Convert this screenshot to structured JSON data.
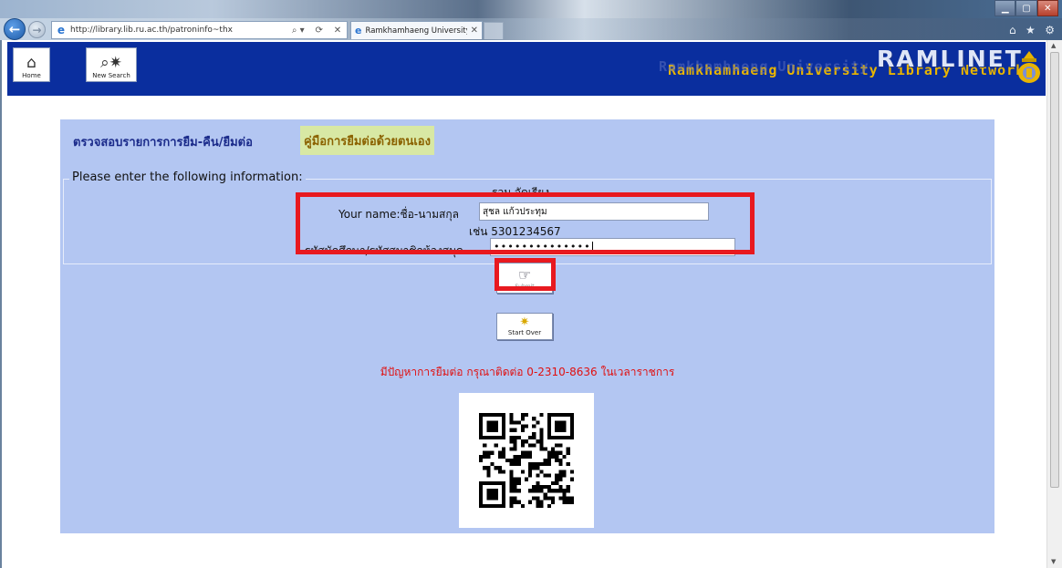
{
  "browser": {
    "url": "http://library.lib.ru.ac.th/patroninfo~thx",
    "tab_title": "Ramkhamhaeng University ...",
    "url_tools": [
      "⌕ ▾",
      "⟳",
      "✕"
    ]
  },
  "header": {
    "home_label": "Home",
    "new_search_label": "New Search",
    "logo_main": "RAMLINET",
    "logo_sub": "Ramkhamhaeng University Library Network",
    "logo_ghost": "Ramkhamhaeng University"
  },
  "form": {
    "title": "ตรวจสอบรายการการยืม-คืน/ยืมต่อ",
    "manual_link": "คู่มือการยืมต่อด้วยตนเอง",
    "legend": "Please enter the following information:",
    "name_hint": "รวม จัดเรียง",
    "name_label": "Your name:ชื่อ-นามสกุล",
    "name_value": "สุชล แก้วประทุม",
    "id_hint": "เช่น 5301234567",
    "id_label": "รหัสนักศึกษา/รหัสสมาชิกห้องสมุด",
    "id_value": "••••••••••••••",
    "submit_label": "Submit",
    "start_over_label": "Start Over",
    "contact": "มีปัญหาการยืมต่อ กรุณาติดต่อ 0-2310-8636 ในเวลาราชการ"
  },
  "colors": {
    "header_bg": "#0a2e9e",
    "panel_bg": "#b3c6f2",
    "highlight": "#e8191f",
    "contact_text": "#e01010",
    "logo_gold": "#e8b400"
  },
  "icons": {
    "home": "house-icon",
    "new_search": "magnifier-sparkle-icon",
    "submit": "submit-hand-icon",
    "start_over": "sparkle-icon"
  }
}
